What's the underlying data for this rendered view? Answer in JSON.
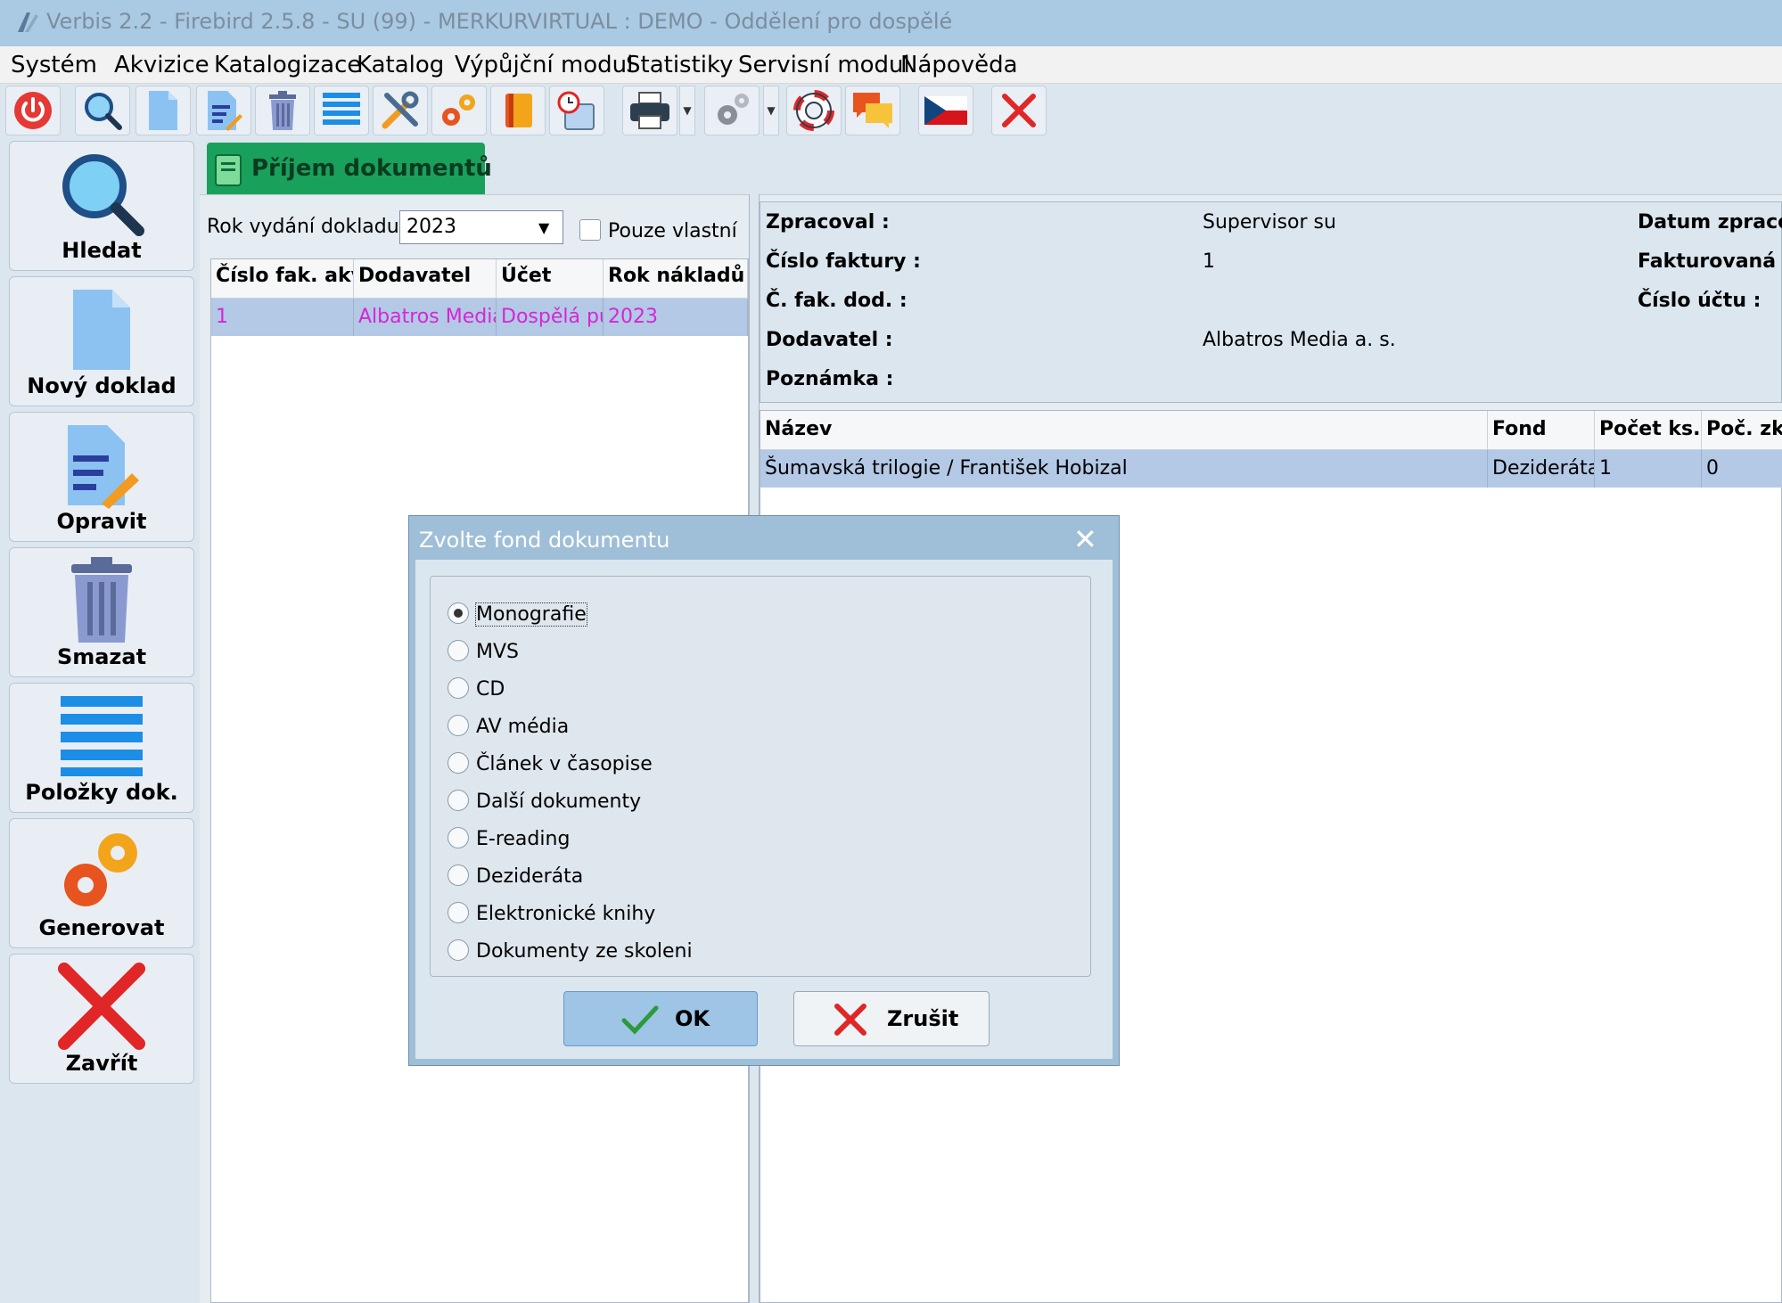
{
  "window": {
    "title": "Verbis 2.2 - Firebird 2.5.8 - SU (99) - MERKURVIRTUAL : DEMO - Oddělení pro dospělé"
  },
  "menu": [
    "Systém",
    "Akvizice",
    "Katalogizace",
    "Katalog",
    "Výpůjční modul",
    "Statistiky",
    "Servisní modul",
    "Nápověda"
  ],
  "toolbar": {
    "icons": [
      "power-icon",
      "search-icon",
      "new-document-icon",
      "edit-icon",
      "trash-icon",
      "list-icon",
      "tools-icon",
      "gears-icon",
      "books-icon",
      "calendar-clock-icon",
      "printer-icon",
      "settings-icon",
      "lifebuoy-icon",
      "chat-icon",
      "czech-flag-icon",
      "close-icon"
    ]
  },
  "sidebar": [
    {
      "label": "Hledat",
      "icon": "search-icon"
    },
    {
      "label": "Nový doklad",
      "icon": "new-document-icon"
    },
    {
      "label": "Opravit",
      "icon": "edit-icon"
    },
    {
      "label": "Smazat",
      "icon": "trash-icon"
    },
    {
      "label": "Položky dok.",
      "icon": "list-icon"
    },
    {
      "label": "Generovat",
      "icon": "gears-icon"
    },
    {
      "label": "Zavřít",
      "icon": "close-icon"
    }
  ],
  "tab": {
    "label": "Příjem dokumentů"
  },
  "filter": {
    "year_label": "Rok vydání dokladu :",
    "year_value": "2023",
    "own_only_label": "Pouze vlastní",
    "own_only_checked": false
  },
  "invoice_grid": {
    "columns": [
      "Číslo fak. akv",
      "Dodavatel",
      "Účet",
      "Rok nákladů"
    ],
    "rows": [
      [
        "1",
        "Albatros Media",
        "Dospělá pů",
        "2023"
      ]
    ]
  },
  "detail": {
    "processed_by_label": "Zpracoval :",
    "processed_by_value": "Supervisor su",
    "processed_date_label": "Datum zpraco",
    "invoice_number_label": "Číslo faktury :",
    "invoice_number_value": "1",
    "invoiced_label": "Fakturovaná č",
    "supplier_invoice_label": "Č. fak. dod. :",
    "account_number_label": "Číslo účtu :",
    "supplier_label": "Dodavatel :",
    "supplier_value": "Albatros Media a. s.",
    "note_label": "Poznámka :"
  },
  "items_grid": {
    "columns": [
      "Název",
      "Fond",
      "Počet ks.",
      "Poč. zka"
    ],
    "rows": [
      [
        "Šumavská trilogie / František Hobizal",
        "Dezideráta",
        "1",
        "0"
      ]
    ]
  },
  "dialog": {
    "title": "Zvolte fond dokumentu",
    "options": [
      "Monografie",
      "MVS",
      "CD",
      "AV média",
      "Článek v časopise",
      "Další dokumenty",
      "E-reading",
      "Dezideráta",
      "Elektronické knihy",
      "Dokumenty ze skoleni"
    ],
    "selected": "Monografie",
    "ok_label": "OK",
    "cancel_label": "Zrušit"
  },
  "colors": {
    "tab_green": "#19a15b",
    "selection_row": "#b3c9e6",
    "link_magenta": "#d626d6",
    "close_red": "#e02626"
  }
}
